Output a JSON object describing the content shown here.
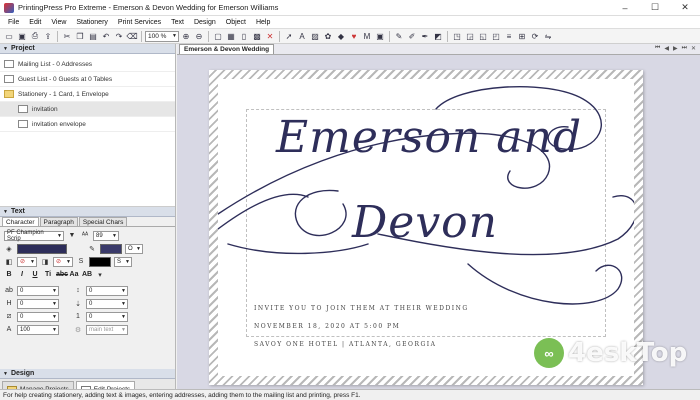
{
  "window": {
    "title": "PrintingPress Pro Extreme - Emerson & Devon Wedding for Emerson Williams",
    "minimize": "–",
    "maximize": "☐",
    "close": "✕"
  },
  "menu": [
    "File",
    "Edit",
    "View",
    "Stationery",
    "Print Services",
    "Text",
    "Design",
    "Object",
    "Help"
  ],
  "toolbar": {
    "zoom": "100 %"
  },
  "project_panel": {
    "header": "Project",
    "items": [
      {
        "label": "Mailing List - 0 Addresses"
      },
      {
        "label": "Guest List - 0 Guests at 0 Tables"
      },
      {
        "label": "Stationery - 1 Card, 1 Envelope"
      },
      {
        "label": "invitation"
      },
      {
        "label": "invitation envelope"
      }
    ]
  },
  "text_panel": {
    "header": "Text",
    "tabs": [
      "Character",
      "Paragraph",
      "Special Chars"
    ],
    "font": "PF Champion Scrip",
    "size": "89",
    "fill_none_1": "⊘",
    "fill_none_2": "⊘",
    "format_buttons": [
      "B",
      "I",
      "U",
      "Ti",
      "abc",
      "Aa",
      "AB"
    ],
    "spacing_values": [
      "0",
      "0",
      "0",
      "0",
      "0",
      "0"
    ],
    "width_value": "100",
    "mode_field": "main text",
    "colors": {
      "text": "#2e2e5a",
      "outline": "#3a3a6a",
      "shadow": "#000000"
    }
  },
  "design_panel": {
    "header": "Design",
    "tabs": [
      "Manage Projects",
      "Edit Projects"
    ]
  },
  "document": {
    "tab": "Emerson & Devon Wedding",
    "script_line_1": "Emerson and",
    "script_line_2": "Devon",
    "invite_line_1": "INVITE YOU TO JOIN THEM AT THEIR WEDDING",
    "invite_line_2": "NOVEMBER 18, 2020 AT 5:00 PM",
    "invite_line_3": "SAVOY ONE HOTEL | ATLANTA, GEORGIA",
    "ink_color": "#2e2e5a"
  },
  "watermark": {
    "text": "4eskTop",
    "logo": "∞"
  },
  "status": "For help creating stationery, adding text & images, entering addresses, adding them to the mailing list and printing, press F1."
}
